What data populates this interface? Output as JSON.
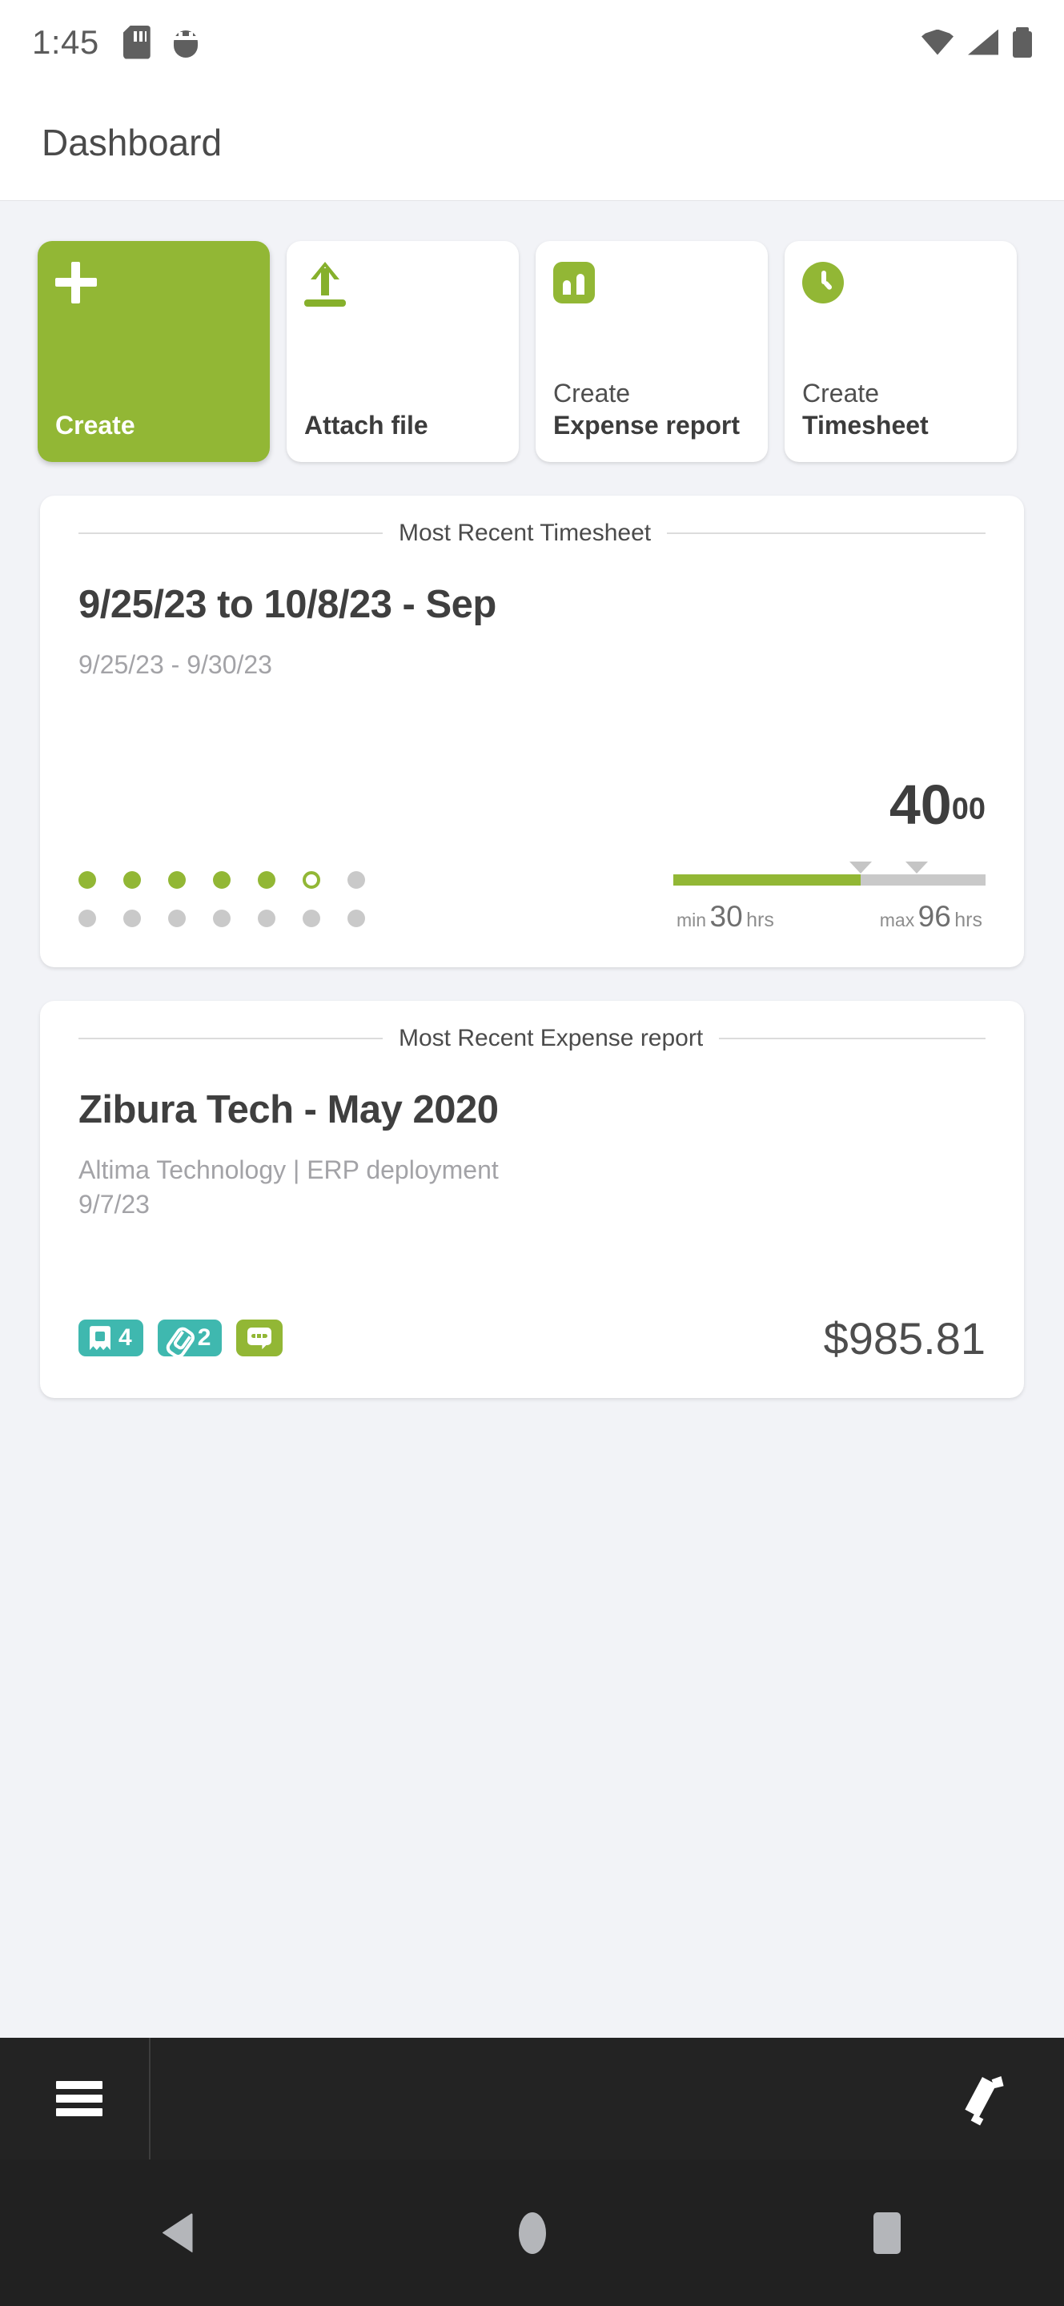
{
  "status_bar": {
    "time": "1:45",
    "left_icons": [
      "sd-card-icon",
      "bug-icon"
    ],
    "right_icons": [
      "wifi-icon",
      "cellular-signal-icon",
      "battery-icon"
    ]
  },
  "app_bar": {
    "title": "Dashboard"
  },
  "quick_actions": [
    {
      "sub": "",
      "main": "Create",
      "icon": "plus-icon",
      "primary": true
    },
    {
      "sub": "",
      "main": "Attach file",
      "icon": "upload-icon",
      "primary": false
    },
    {
      "sub": "Create",
      "main": "Expense report",
      "icon": "bar-chart-icon",
      "primary": false
    },
    {
      "sub": "Create",
      "main": "Timesheet",
      "icon": "clock-icon",
      "primary": false
    }
  ],
  "timesheet_card": {
    "header": "Most Recent Timesheet",
    "title": "9/25/23 to 10/8/23 - Sep",
    "subtitle": "9/25/23 - 9/30/23",
    "days_row1": [
      "filled",
      "filled",
      "filled",
      "filled",
      "filled",
      "hollow",
      "empty"
    ],
    "days_row2": [
      "empty",
      "empty",
      "empty",
      "empty",
      "empty",
      "empty",
      "empty"
    ],
    "hours_whole": "40",
    "hours_fraction": "00",
    "progress_percent": 60,
    "min_marker_percent": 60,
    "max_marker_percent": 78,
    "min_word": "min",
    "min_value": "30",
    "min_unit": "hrs",
    "max_word": "max",
    "max_value": "96",
    "max_unit": "hrs"
  },
  "expense_card": {
    "header": "Most Recent Expense report",
    "title": "Zibura Tech - May 2020",
    "subtitle_line1": "Altima Technology | ERP deployment",
    "subtitle_line2": "9/7/23",
    "badges": [
      {
        "icon": "receipt-icon",
        "count": "4",
        "color": "#3FB8AF"
      },
      {
        "icon": "paperclip-icon",
        "count": "2",
        "color": "#3FB8AF"
      },
      {
        "icon": "comment-icon",
        "count": "",
        "color": "#92B735"
      }
    ],
    "amount": "$985.81"
  },
  "bottom_bar": {
    "menu_icon": "hamburger-menu-icon",
    "edit_icon": "pencil-edit-icon"
  },
  "nav_bar": {
    "back": "back-triangle-icon",
    "home": "home-circle-icon",
    "recents": "recents-square-icon"
  },
  "colors": {
    "brand_green": "#92B735",
    "badge_teal": "#3FB8AF",
    "page_background": "#F2F3F7",
    "bottom_bar": "#232323"
  }
}
